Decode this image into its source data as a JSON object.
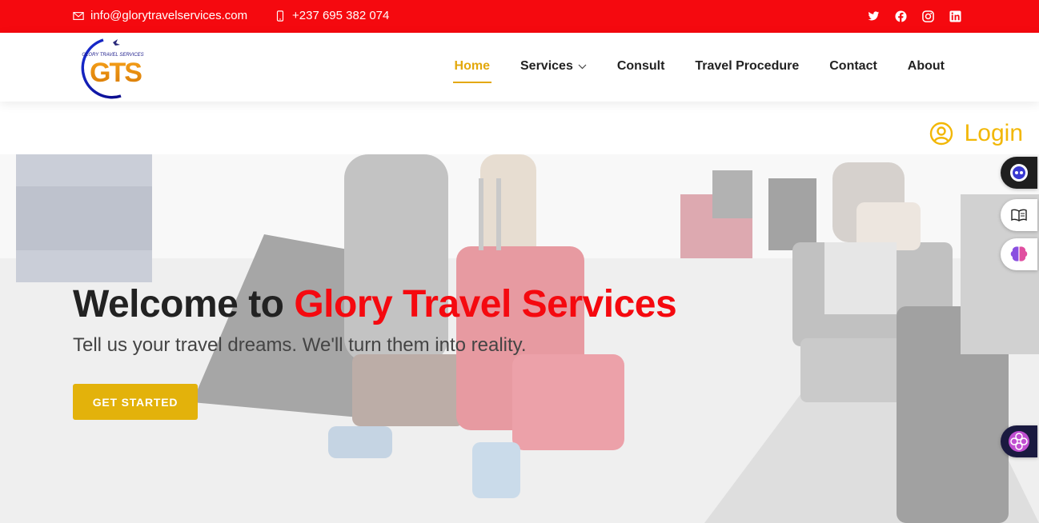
{
  "topbar": {
    "email": "info@glorytravelservices.com",
    "phone": "+237 695 382 074",
    "social": [
      "twitter-icon",
      "facebook-icon",
      "instagram-icon",
      "linkedin-icon"
    ]
  },
  "brand": {
    "logo_text": "GTS",
    "logo_tagline": "GLORY TRAVEL SERVICES"
  },
  "nav": {
    "items": [
      {
        "label": "Home",
        "active": true
      },
      {
        "label": "Services",
        "dropdown": true
      },
      {
        "label": "Consult"
      },
      {
        "label": "Travel Procedure"
      },
      {
        "label": "Contact"
      },
      {
        "label": "About"
      }
    ]
  },
  "login": {
    "label": "Login"
  },
  "hero": {
    "title_prefix": "Welcome to ",
    "title_brand": "Glory Travel Services",
    "subtitle": "Tell us your travel dreams. We'll turn them into reality.",
    "cta_label": "GET STARTED"
  },
  "colors": {
    "topbar": "#f5090f",
    "accent": "#e3b20b",
    "login": "#f2b705",
    "brand_red": "#f5090f"
  }
}
